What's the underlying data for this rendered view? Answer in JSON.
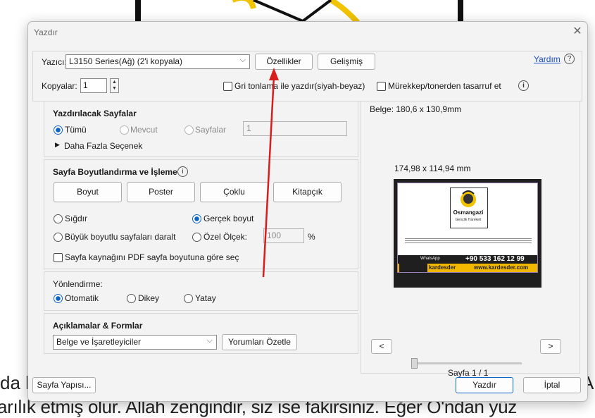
{
  "background": {
    "left_text": "da l",
    "right_text": "Ar",
    "bottom_text": "arılık etmiş olur. Allah zengindir, siz ise fakirsiniz. Eğer O'ndan yüz"
  },
  "dialog": {
    "title": "Yazdır",
    "close_glyph": "✕"
  },
  "printer": {
    "label": "Yazıcı:",
    "value": "L3150 Series(Ağ) (2'i kopyala)",
    "properties_button": "Özellikler",
    "advanced_button": "Gelişmiş",
    "help_link": "Yardım",
    "help_icon": "?"
  },
  "copies": {
    "label": "Kopyalar:",
    "value": "1",
    "grayscale_label": "Gri tonlama ile yazdır(siyah-beyaz)",
    "save_ink_label": "Mürekkep/tonerden tasarruf et",
    "info_icon": "i"
  },
  "pages_to_print": {
    "heading": "Yazdırılacak Sayfalar",
    "all_label": "Tümü",
    "current_label": "Mevcut",
    "pages_label": "Sayfalar",
    "pages_value": "1",
    "more_options": "Daha Fazla Seçenek",
    "selected": "all"
  },
  "sizing": {
    "heading": "Sayfa Boyutlandırma ve İşleme",
    "info_icon": "i",
    "size_button": "Boyut",
    "poster_button": "Poster",
    "multiple_button": "Çoklu",
    "booklet_button": "Kitapçık",
    "fit_label": "Sığdır",
    "actual_size_label": "Gerçek boyut",
    "shrink_label": "Büyük boyutlu sayfaları daralt",
    "custom_scale_label": "Özel Ölçek:",
    "custom_scale_value": "100",
    "percent": "%",
    "paper_source_label": "Sayfa kaynağını PDF sayfa boyutuna göre seç",
    "selected": "actual"
  },
  "orientation": {
    "heading": "Yönlendirme:",
    "auto_label": "Otomatik",
    "portrait_label": "Dikey",
    "landscape_label": "Yatay",
    "selected": "auto"
  },
  "comments": {
    "heading": "Açıklamalar & Formlar",
    "value": "Belge ve İşaretleyiciler",
    "summarize_button": "Yorumları Özetle"
  },
  "preview": {
    "doc_size": "Belge: 180,6 x 130,9mm",
    "page_size": "174,98 x 114,94 mm",
    "prev": "<",
    "next": ">",
    "page_indicator": "Sayfa 1 / 1",
    "thumbnail": {
      "logo_line1": "Osmangazi",
      "logo_line2": "Gençlik Hareketi",
      "whatsapp_label": "WhatsApp",
      "phone": "+90 533 162 12 99",
      "handle": "kardesder",
      "website": "www.kardesder.com"
    }
  },
  "footer": {
    "page_setup_button": "Sayfa Yapısı...",
    "print_button": "Yazdır",
    "cancel_button": "İptal"
  },
  "colors": {
    "accent": "#0a64c8",
    "annotation_arrow": "#d61e1e",
    "thumb_banner": "#1f1f1f",
    "thumb_strip": "#f2b800"
  }
}
